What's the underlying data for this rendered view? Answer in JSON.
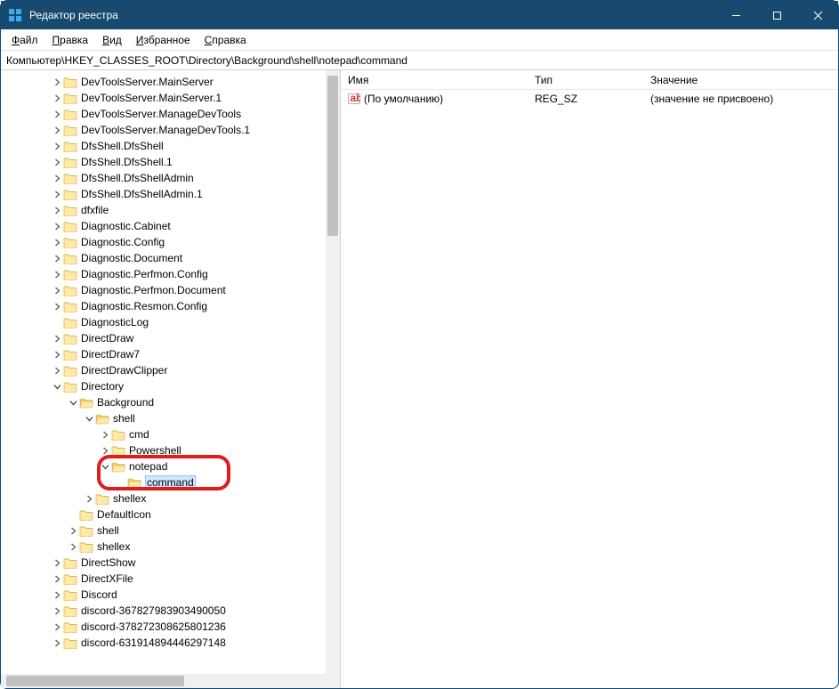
{
  "window": {
    "title": "Редактор реестра"
  },
  "menu": {
    "file": "Файл",
    "edit": "Правка",
    "view": "Вид",
    "favorites": "Избранное",
    "help": "Справка"
  },
  "path": "Компьютер\\HKEY_CLASSES_ROOT\\Directory\\Background\\shell\\notepad\\command",
  "tree": [
    {
      "indent": 56,
      "exp": "closed",
      "label": "DevToolsServer.MainServer"
    },
    {
      "indent": 56,
      "exp": "closed",
      "label": "DevToolsServer.MainServer.1"
    },
    {
      "indent": 56,
      "exp": "closed",
      "label": "DevToolsServer.ManageDevTools"
    },
    {
      "indent": 56,
      "exp": "closed",
      "label": "DevToolsServer.ManageDevTools.1"
    },
    {
      "indent": 56,
      "exp": "closed",
      "label": "DfsShell.DfsShell"
    },
    {
      "indent": 56,
      "exp": "closed",
      "label": "DfsShell.DfsShell.1"
    },
    {
      "indent": 56,
      "exp": "closed",
      "label": "DfsShell.DfsShellAdmin"
    },
    {
      "indent": 56,
      "exp": "closed",
      "label": "DfsShell.DfsShellAdmin.1"
    },
    {
      "indent": 56,
      "exp": "closed",
      "label": "dfxfile"
    },
    {
      "indent": 56,
      "exp": "closed",
      "label": "Diagnostic.Cabinet"
    },
    {
      "indent": 56,
      "exp": "closed",
      "label": "Diagnostic.Config"
    },
    {
      "indent": 56,
      "exp": "closed",
      "label": "Diagnostic.Document"
    },
    {
      "indent": 56,
      "exp": "closed",
      "label": "Diagnostic.Perfmon.Config"
    },
    {
      "indent": 56,
      "exp": "closed",
      "label": "Diagnostic.Perfmon.Document"
    },
    {
      "indent": 56,
      "exp": "closed",
      "label": "Diagnostic.Resmon.Config"
    },
    {
      "indent": 56,
      "exp": "none",
      "label": "DiagnosticLog"
    },
    {
      "indent": 56,
      "exp": "closed",
      "label": "DirectDraw"
    },
    {
      "indent": 56,
      "exp": "closed",
      "label": "DirectDraw7"
    },
    {
      "indent": 56,
      "exp": "closed",
      "label": "DirectDrawClipper"
    },
    {
      "indent": 56,
      "exp": "open",
      "label": "Directory"
    },
    {
      "indent": 74,
      "exp": "open",
      "label": "Background",
      "open": true
    },
    {
      "indent": 92,
      "exp": "open",
      "label": "shell",
      "open": true
    },
    {
      "indent": 110,
      "exp": "closed",
      "label": "cmd"
    },
    {
      "indent": 110,
      "exp": "closed",
      "label": "Powershell"
    },
    {
      "indent": 110,
      "exp": "open",
      "label": "notepad",
      "open": true
    },
    {
      "indent": 128,
      "exp": "none",
      "label": "command",
      "open": true,
      "selected": true
    },
    {
      "indent": 92,
      "exp": "closed",
      "label": "shellex"
    },
    {
      "indent": 74,
      "exp": "none",
      "label": "DefaultIcon"
    },
    {
      "indent": 74,
      "exp": "closed",
      "label": "shell"
    },
    {
      "indent": 74,
      "exp": "closed",
      "label": "shellex"
    },
    {
      "indent": 56,
      "exp": "closed",
      "label": "DirectShow"
    },
    {
      "indent": 56,
      "exp": "closed",
      "label": "DirectXFile"
    },
    {
      "indent": 56,
      "exp": "closed",
      "label": "Discord"
    },
    {
      "indent": 56,
      "exp": "closed",
      "label": "discord-367827983903490050"
    },
    {
      "indent": 56,
      "exp": "closed",
      "label": "discord-378272308625801236"
    },
    {
      "indent": 56,
      "exp": "closed",
      "label": "discord-631914894446297148"
    }
  ],
  "list": {
    "headers": {
      "name": "Имя",
      "type": "Тип",
      "value": "Значение"
    },
    "rows": [
      {
        "name": "(По умолчанию)",
        "type": "REG_SZ",
        "value": "(значение не присвоено)"
      }
    ]
  }
}
